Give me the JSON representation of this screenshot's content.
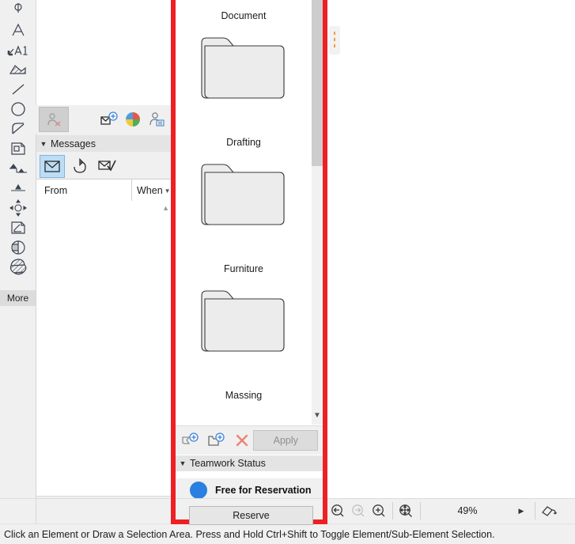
{
  "app": {
    "status_bar_text": "Click an Element or Draw a Selection Area. Press and Hold Ctrl+Shift to Toggle Element/Sub-Element Selection."
  },
  "left_toolbar": {
    "more_label": "More",
    "tools": [
      {
        "name": "dimension-tool-icon",
        "label": "Dimension"
      },
      {
        "name": "text-tool-icon",
        "label": "Text"
      },
      {
        "name": "label-a1-tool-icon",
        "label": "Label"
      },
      {
        "name": "fill-hatch-tool-icon",
        "label": "Fill"
      },
      {
        "name": "line-tool-icon",
        "label": "Line"
      },
      {
        "name": "circle-tool-icon",
        "label": "Circle"
      },
      {
        "name": "polyline-tool-icon",
        "label": "Polyline"
      },
      {
        "name": "figure-drawing-tool-icon",
        "label": "Drawing"
      },
      {
        "name": "level-dimension-tool-icon",
        "label": "Level Dimension"
      },
      {
        "name": "elevation-marker-tool-icon",
        "label": "Elevation"
      },
      {
        "name": "hotspot-tool-icon",
        "label": "Hotspot"
      },
      {
        "name": "annotation-tool-icon",
        "label": "Annotation"
      },
      {
        "name": "section-tool-icon",
        "label": "Section"
      },
      {
        "name": "morph-tool-icon",
        "label": "Morph"
      }
    ]
  },
  "palette": {
    "toolbar_icons": [
      {
        "name": "user-remove-icon",
        "label": "Remove User",
        "state": "disabled-pressed"
      },
      {
        "name": "new-message-icon",
        "label": "New Message",
        "state": "enabled"
      },
      {
        "name": "color-wheel-icon",
        "label": "User Colors",
        "state": "enabled"
      },
      {
        "name": "user-info-icon",
        "label": "User Info",
        "state": "enabled"
      }
    ],
    "messages": {
      "header_title": "Messages",
      "collapse_glyph": "▼",
      "filters": [
        {
          "name": "filter-all-messages-icon",
          "label": "All Messages",
          "selected": true
        },
        {
          "name": "filter-sent-messages-icon",
          "label": "Sent Messages",
          "selected": false
        },
        {
          "name": "filter-read-messages-icon",
          "label": "Read Messages",
          "selected": false
        }
      ],
      "columns": {
        "from": "From",
        "when": "When",
        "sort_glyph": "▼"
      },
      "rows": [],
      "scroll_up_glyph": "▲"
    },
    "bottom_icons": [
      {
        "name": "new-message-icon",
        "label": "New Message",
        "state": "enabled"
      },
      {
        "name": "reply-message-icon",
        "label": "Reply",
        "state": "disabled"
      },
      {
        "name": "mark-read-icon",
        "label": "Mark as Read",
        "state": "disabled"
      }
    ]
  },
  "teamwork_panel": {
    "folders": [
      {
        "label": "Document",
        "icon": "folder-icon"
      },
      {
        "label": "Drafting",
        "icon": "folder-icon"
      },
      {
        "label": "Furniture",
        "icon": "folder-icon"
      },
      {
        "label": "Massing",
        "icon": "folder-icon"
      }
    ],
    "scroll_down_glyph": "▼",
    "actions": [
      {
        "name": "add-element-icon",
        "label": "Add Element"
      },
      {
        "name": "add-folder-icon",
        "label": "Add Folder"
      },
      {
        "name": "delete-icon",
        "label": "Delete"
      }
    ],
    "apply_label": "Apply",
    "status": {
      "header_title": "Teamwork Status",
      "collapse_glyph": "▼",
      "dot_color": "#2a7fe0",
      "state_label": "Free for Reservation",
      "reserve_label": "Reserve"
    }
  },
  "drag_handle": {
    "name": "drag-handle",
    "color": "#f39c3d"
  },
  "bottom_bar": {
    "zoom_tools": [
      {
        "name": "zoom-previous-icon",
        "label": "Previous Zoom",
        "state": "enabled"
      },
      {
        "name": "zoom-next-icon",
        "label": "Next Zoom",
        "state": "disabled"
      },
      {
        "name": "zoom-in-icon",
        "label": "Zoom In",
        "state": "enabled"
      },
      {
        "name": "fit-in-window-icon",
        "label": "Fit in Window",
        "state": "enabled"
      }
    ],
    "zoom_value": "49%",
    "next_glyph": "▶",
    "orbit_icon": {
      "name": "orbit-icon",
      "label": "Orbit"
    }
  },
  "highlight": {
    "color": "#ed2024"
  }
}
